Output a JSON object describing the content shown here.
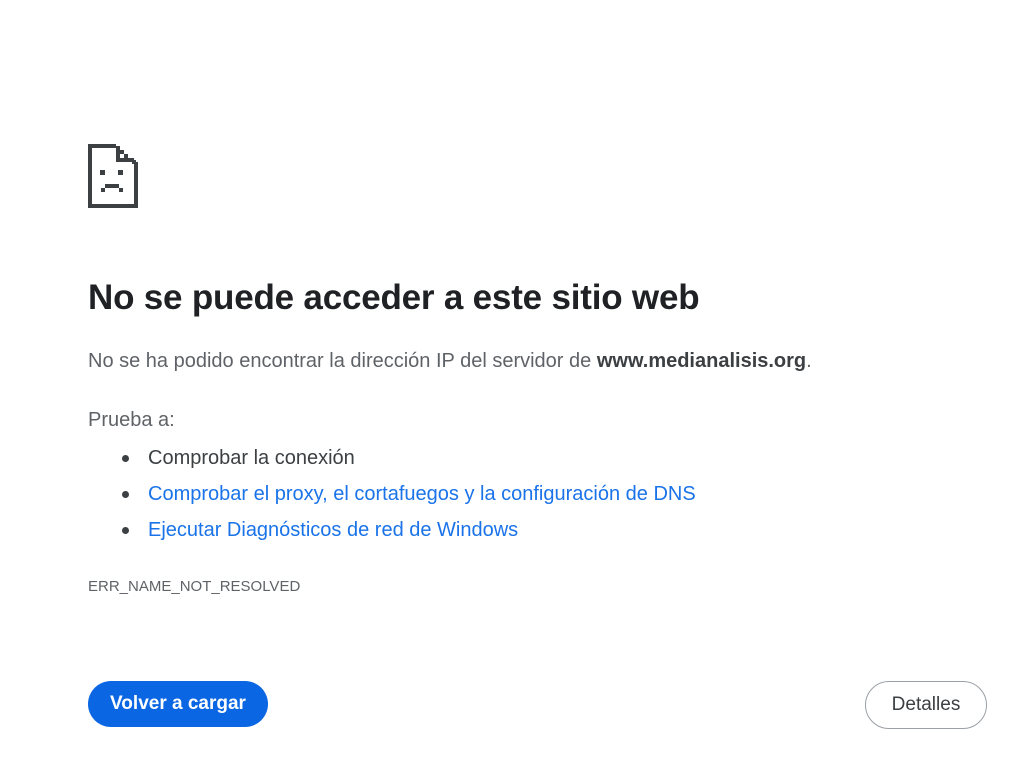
{
  "error_page": {
    "icon": "sad-page-icon",
    "heading": "No se puede acceder a este sitio web",
    "summary_prefix": "No se ha podido encontrar la dirección IP del servidor de ",
    "summary_host": "www.medianalisis.org",
    "summary_suffix": ".",
    "suggestions_heading": "Prueba a:",
    "suggestions": [
      {
        "label": "Comprobar la conexión",
        "is_link": false
      },
      {
        "label": "Comprobar el proxy, el cortafuegos y la configuración de DNS",
        "is_link": true
      },
      {
        "label": "Ejecutar Diagnósticos de red de Windows",
        "is_link": true
      }
    ],
    "error_code": "ERR_NAME_NOT_RESOLVED",
    "reload_label": "Volver a cargar",
    "details_label": "Detalles"
  },
  "colors": {
    "heading": "#202124",
    "body_text": "#5f6368",
    "link": "#1a73e8",
    "primary_button": "#0b66e4",
    "secondary_button_border": "#9aa0a6"
  }
}
